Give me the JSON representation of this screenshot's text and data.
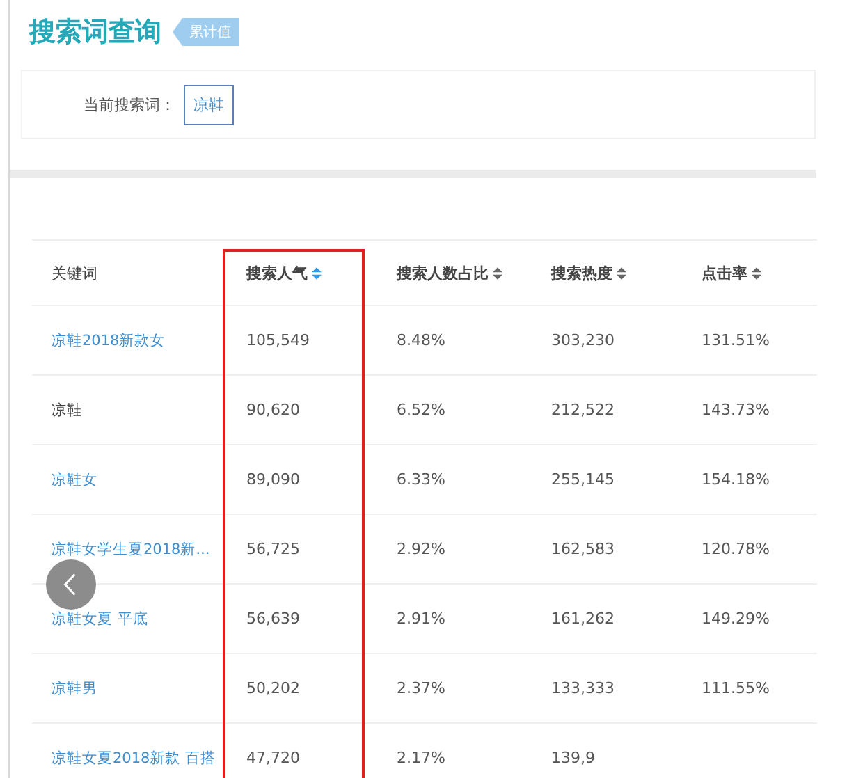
{
  "header": {
    "title": "搜索词查询",
    "badge": "累计值"
  },
  "search": {
    "label": "当前搜索词：",
    "term": "凉鞋"
  },
  "table": {
    "columns": [
      {
        "label": "关键词",
        "sortable": false,
        "sort_active": false,
        "highlighted": false
      },
      {
        "label": "搜索人气",
        "sortable": true,
        "sort_active": true,
        "highlighted": true
      },
      {
        "label": "搜索人数占比",
        "sortable": true,
        "sort_active": false,
        "highlighted": false
      },
      {
        "label": "搜索热度",
        "sortable": true,
        "sort_active": false,
        "highlighted": false
      },
      {
        "label": "点击率",
        "sortable": true,
        "sort_active": false,
        "highlighted": false
      }
    ],
    "rows": [
      {
        "link": true,
        "cells": [
          "凉鞋2018新款女",
          "105,549",
          "8.48%",
          "303,230",
          "131.51%"
        ]
      },
      {
        "link": false,
        "cells": [
          "凉鞋",
          "90,620",
          "6.52%",
          "212,522",
          "143.73%"
        ]
      },
      {
        "link": true,
        "cells": [
          "凉鞋女",
          "89,090",
          "6.33%",
          "255,145",
          "154.18%"
        ]
      },
      {
        "link": true,
        "cells": [
          "凉鞋女学生夏2018新...",
          "56,725",
          "2.92%",
          "162,583",
          "120.78%"
        ]
      },
      {
        "link": true,
        "cells": [
          "凉鞋女夏 平底",
          "56,639",
          "2.91%",
          "161,262",
          "149.29%"
        ]
      },
      {
        "link": true,
        "cells": [
          "凉鞋男",
          "50,202",
          "2.37%",
          "133,333",
          "111.55%"
        ]
      },
      {
        "link": true,
        "cells": [
          "凉鞋女夏2018新款 百搭",
          "47,720",
          "2.17%",
          "139,9"
        ]
      }
    ]
  }
}
